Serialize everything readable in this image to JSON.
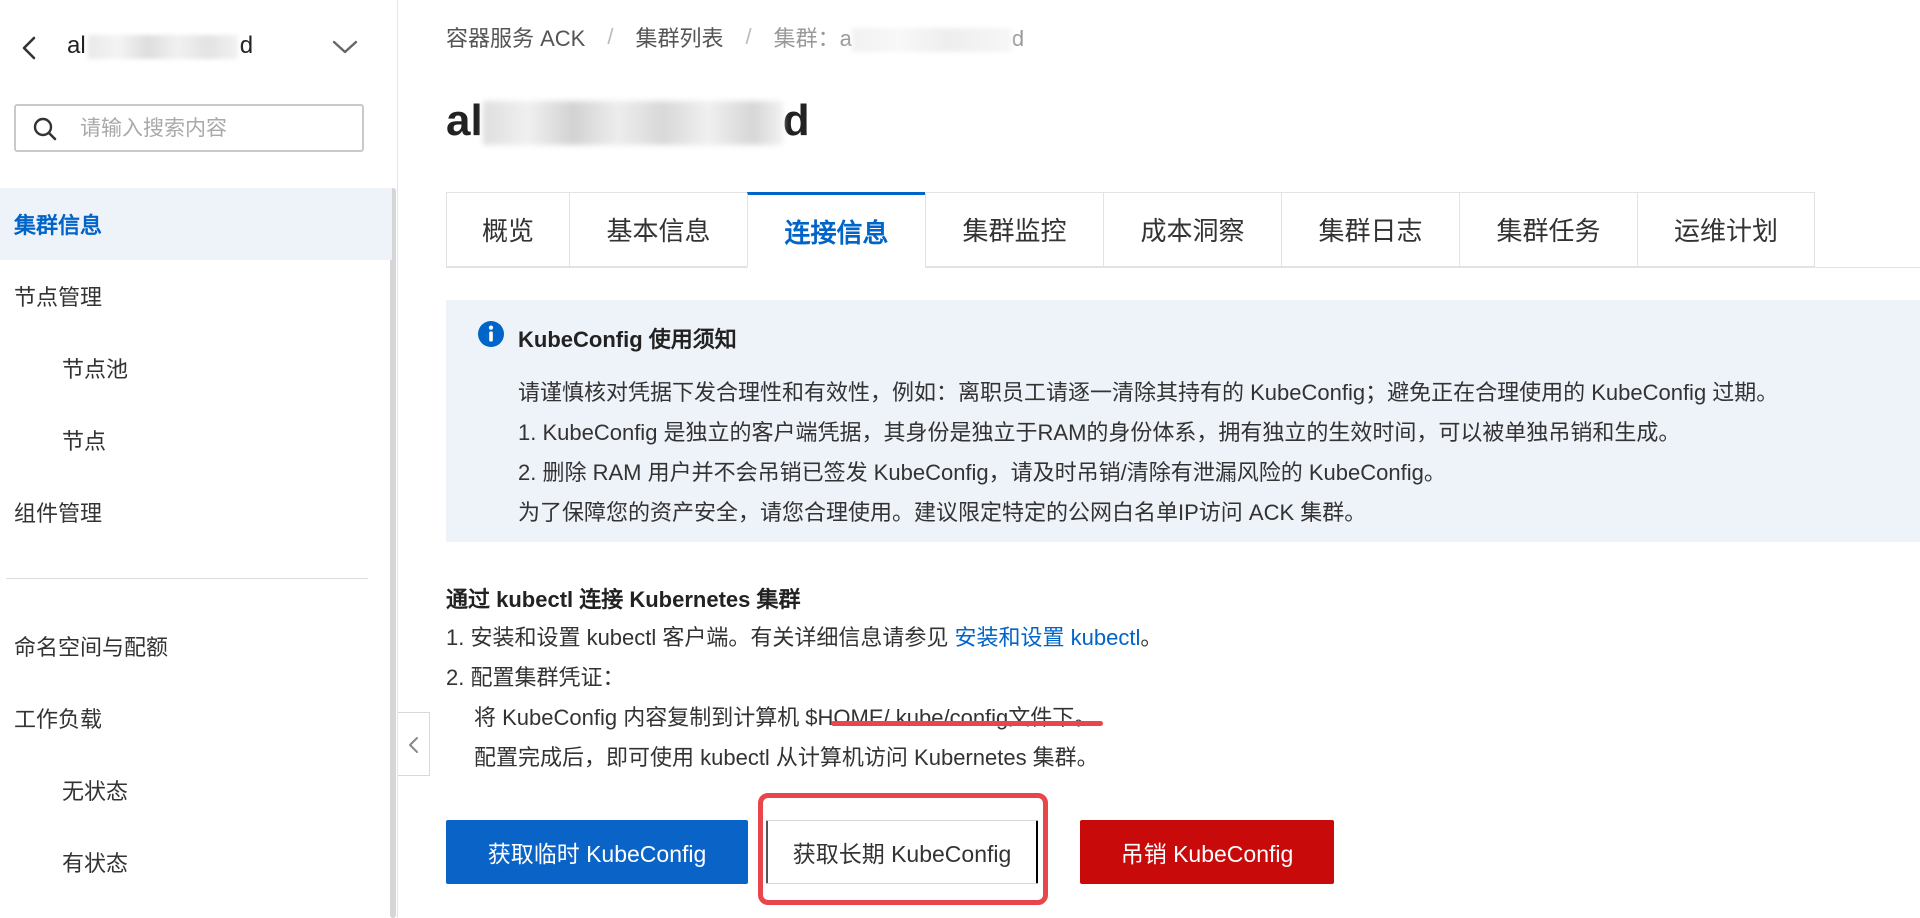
{
  "sidebar": {
    "cluster_name_prefix": "al",
    "cluster_name_suffix": "d",
    "search_placeholder": "请输入搜索内容",
    "items": [
      {
        "label": "集群信息"
      },
      {
        "label": "节点管理"
      },
      {
        "label": "节点池"
      },
      {
        "label": "节点"
      },
      {
        "label": "组件管理"
      },
      {
        "label": "命名空间与配额"
      },
      {
        "label": "工作负载"
      },
      {
        "label": "无状态"
      },
      {
        "label": "有状态"
      }
    ]
  },
  "breadcrumb": {
    "items": [
      "容器服务 ACK",
      "集群列表"
    ],
    "current_prefix": "集群：a",
    "current_suffix": "d",
    "separator": "/"
  },
  "page": {
    "title_prefix": "al",
    "title_suffix": "d"
  },
  "tabs": [
    {
      "label": "概览"
    },
    {
      "label": "基本信息"
    },
    {
      "label": "连接信息"
    },
    {
      "label": "集群监控"
    },
    {
      "label": "成本洞察"
    },
    {
      "label": "集群日志"
    },
    {
      "label": "集群任务"
    },
    {
      "label": "运维计划"
    }
  ],
  "active_tab": "连接信息",
  "notice": {
    "title": "KubeConfig 使用须知",
    "lines": [
      "请谨慎核对凭据下发合理性和有效性，例如：离职员工请逐一清除其持有的 KubeConfig；避免正在合理使用的 KubeConfig 过期。",
      "1. KubeConfig 是独立的客户端凭据，其身份是独立于RAM的身份体系，拥有独立的生效时间，可以被单独吊销和生成。",
      "2. 删除 RAM 用户并不会吊销已签发 KubeConfig，请及时吊销/清除有泄漏风险的 KubeConfig。",
      "为了保障您的资产安全，请您合理使用。建议限定特定的公网白名单IP访问 ACK 集群。"
    ]
  },
  "kubectl_section": {
    "title": "通过 kubectl 连接 Kubernetes 集群",
    "step1_prefix": "1. 安装和设置 kubectl 客户端。有关详细信息请参见 ",
    "step1_link": "安装和设置 kubectl",
    "step1_suffix": "。",
    "step2": "2. 配置集群凭证：",
    "step2_line1": "将 KubeConfig 内容复制到计算机 $HOME/.kube/config文件下。",
    "step2_line2": "配置完成后，即可使用 kubectl 从计算机访问 Kubernetes 集群。"
  },
  "buttons": {
    "temp_kubeconfig": "获取临时 KubeConfig",
    "long_kubeconfig": "获取长期 KubeConfig",
    "revoke_kubeconfig": "吊销 KubeConfig"
  },
  "colors": {
    "accent": "#0064c8",
    "danger": "#c80a0a",
    "annotation": "#e8464b",
    "notice_bg": "#eef2f9"
  },
  "icons": {
    "back": "chevron-left-icon",
    "dropdown": "chevron-down-icon",
    "search": "search-icon",
    "info": "info-circle-icon",
    "collapse": "chevron-left-icon"
  }
}
